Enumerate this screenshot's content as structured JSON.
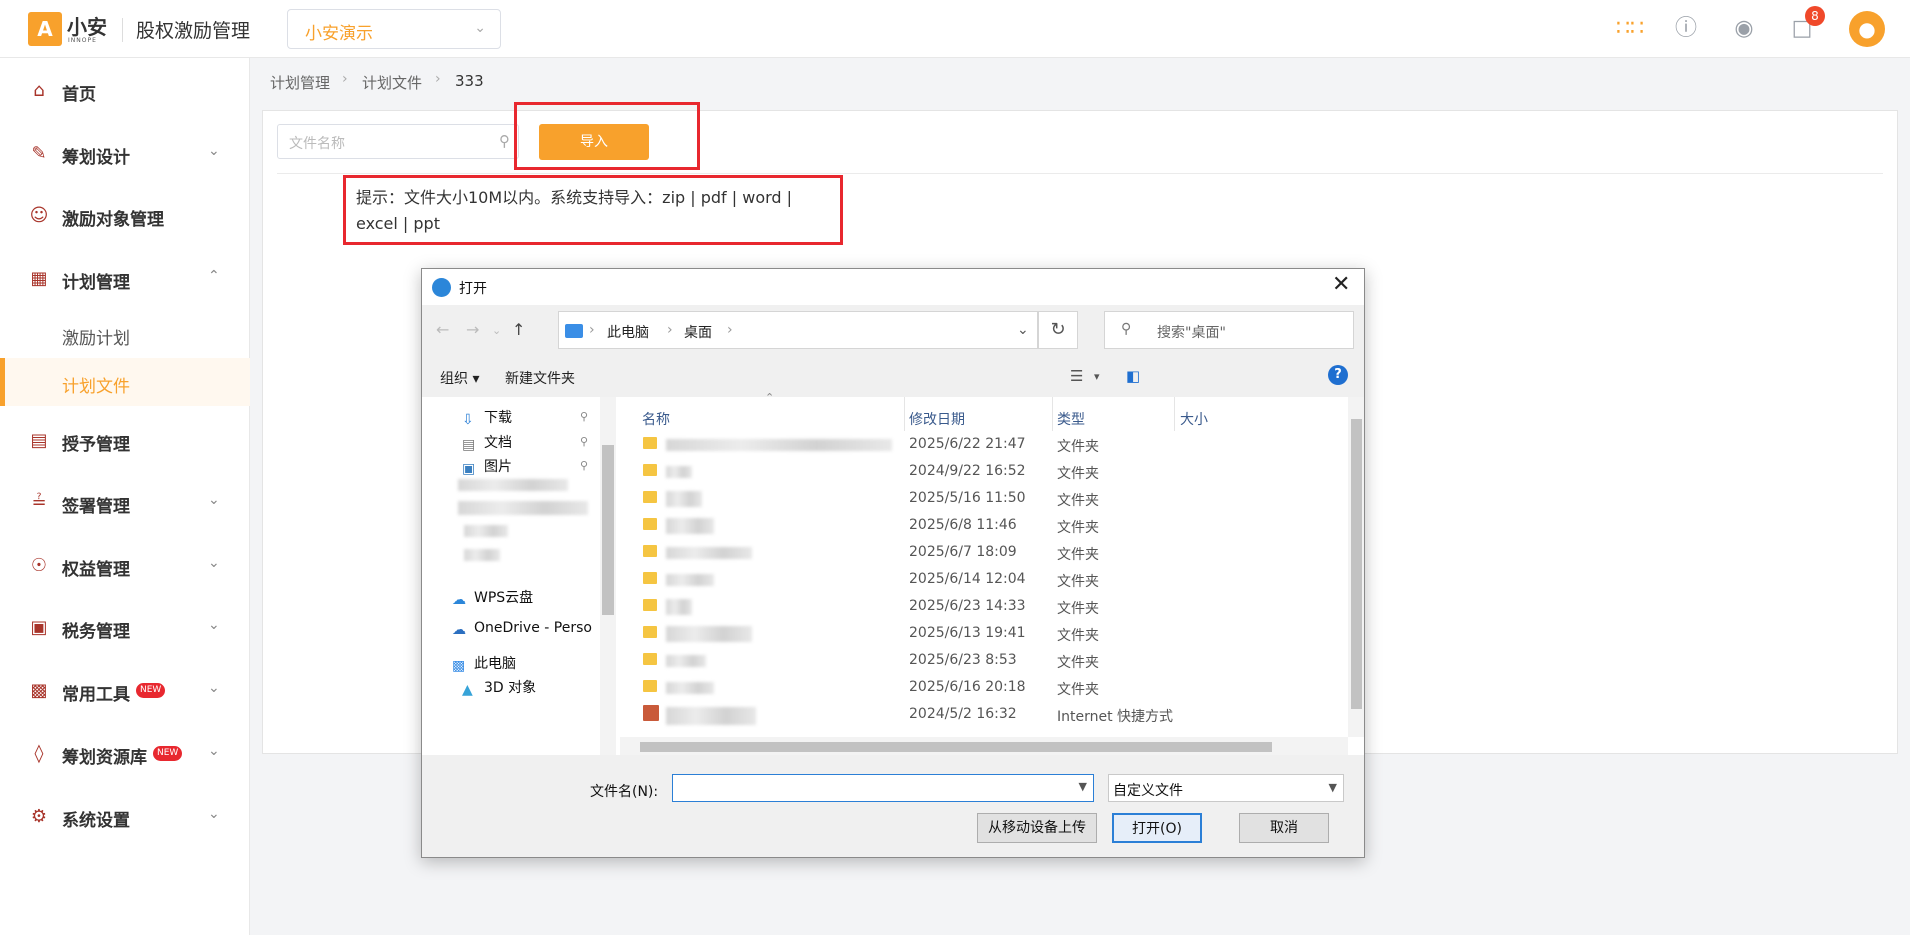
{
  "header": {
    "logo_mark": "A",
    "logo_text": "小安",
    "logo_sub": "INNOPE",
    "app_title": "股权激励管理",
    "company": "小安演示",
    "notifications": "8"
  },
  "sidebar": {
    "items": [
      {
        "label": "首页",
        "icon": "home-icon"
      },
      {
        "label": "筹划设计",
        "icon": "edit-icon"
      },
      {
        "label": "激励对象管理",
        "icon": "users-icon"
      },
      {
        "label": "计划管理",
        "icon": "grid-icon"
      },
      {
        "label": "授予管理",
        "icon": "book-icon"
      },
      {
        "label": "签署管理",
        "icon": "sign-icon"
      },
      {
        "label": "权益管理",
        "icon": "shield-icon"
      },
      {
        "label": "税务管理",
        "icon": "tax-icon"
      },
      {
        "label": "常用工具",
        "icon": "toolbox-icon",
        "badge": "NEW"
      },
      {
        "label": "筹划资源库",
        "icon": "layers-icon",
        "badge": "NEW"
      },
      {
        "label": "系统设置",
        "icon": "gear-icon"
      }
    ],
    "sub_items": [
      "激励计划",
      "计划文件"
    ]
  },
  "breadcrumb": [
    "计划管理",
    "计划文件",
    "333"
  ],
  "toolbar": {
    "search_placeholder": "文件名称",
    "import_label": "导入"
  },
  "hint": "提示：文件大小10M以内。系统支持导入：zip | pdf | word | excel | ppt",
  "dialog": {
    "title": "打开",
    "path": [
      "此电脑",
      "桌面"
    ],
    "search_placeholder": "搜索\"桌面\"",
    "organize": "组织",
    "new_folder": "新建文件夹",
    "tree": [
      "下载",
      "文档",
      "图片",
      "WPS云盘",
      "OneDrive - Perso",
      "此电脑",
      "3D 对象"
    ],
    "columns": [
      "名称",
      "修改日期",
      "类型",
      "大小"
    ],
    "rows": [
      {
        "date": "2025/6/22 21:47",
        "type": "文件夹"
      },
      {
        "date": "2024/9/22 16:52",
        "type": "文件夹"
      },
      {
        "date": "2025/5/16 11:50",
        "type": "文件夹"
      },
      {
        "date": "2025/6/8 11:46",
        "type": "文件夹"
      },
      {
        "date": "2025/6/7 18:09",
        "type": "文件夹"
      },
      {
        "date": "2025/6/14 12:04",
        "type": "文件夹"
      },
      {
        "date": "2025/6/23 14:33",
        "type": "文件夹"
      },
      {
        "date": "2025/6/13 19:41",
        "type": "文件夹"
      },
      {
        "date": "2025/6/23 8:53",
        "type": "文件夹"
      },
      {
        "date": "2025/6/16 20:18",
        "type": "文件夹"
      },
      {
        "date": "2024/5/2 16:32",
        "type": "Internet 快捷方式"
      }
    ],
    "filename_label": "文件名(N):",
    "filename_value": "",
    "filetype": "自定义文件",
    "upload_mobile": "从移动设备上传",
    "open": "打开(O)",
    "cancel": "取消"
  },
  "colors": {
    "accent": "#f8a12c",
    "highlight": "#e8282f",
    "nav_icon": "#a8342a"
  }
}
